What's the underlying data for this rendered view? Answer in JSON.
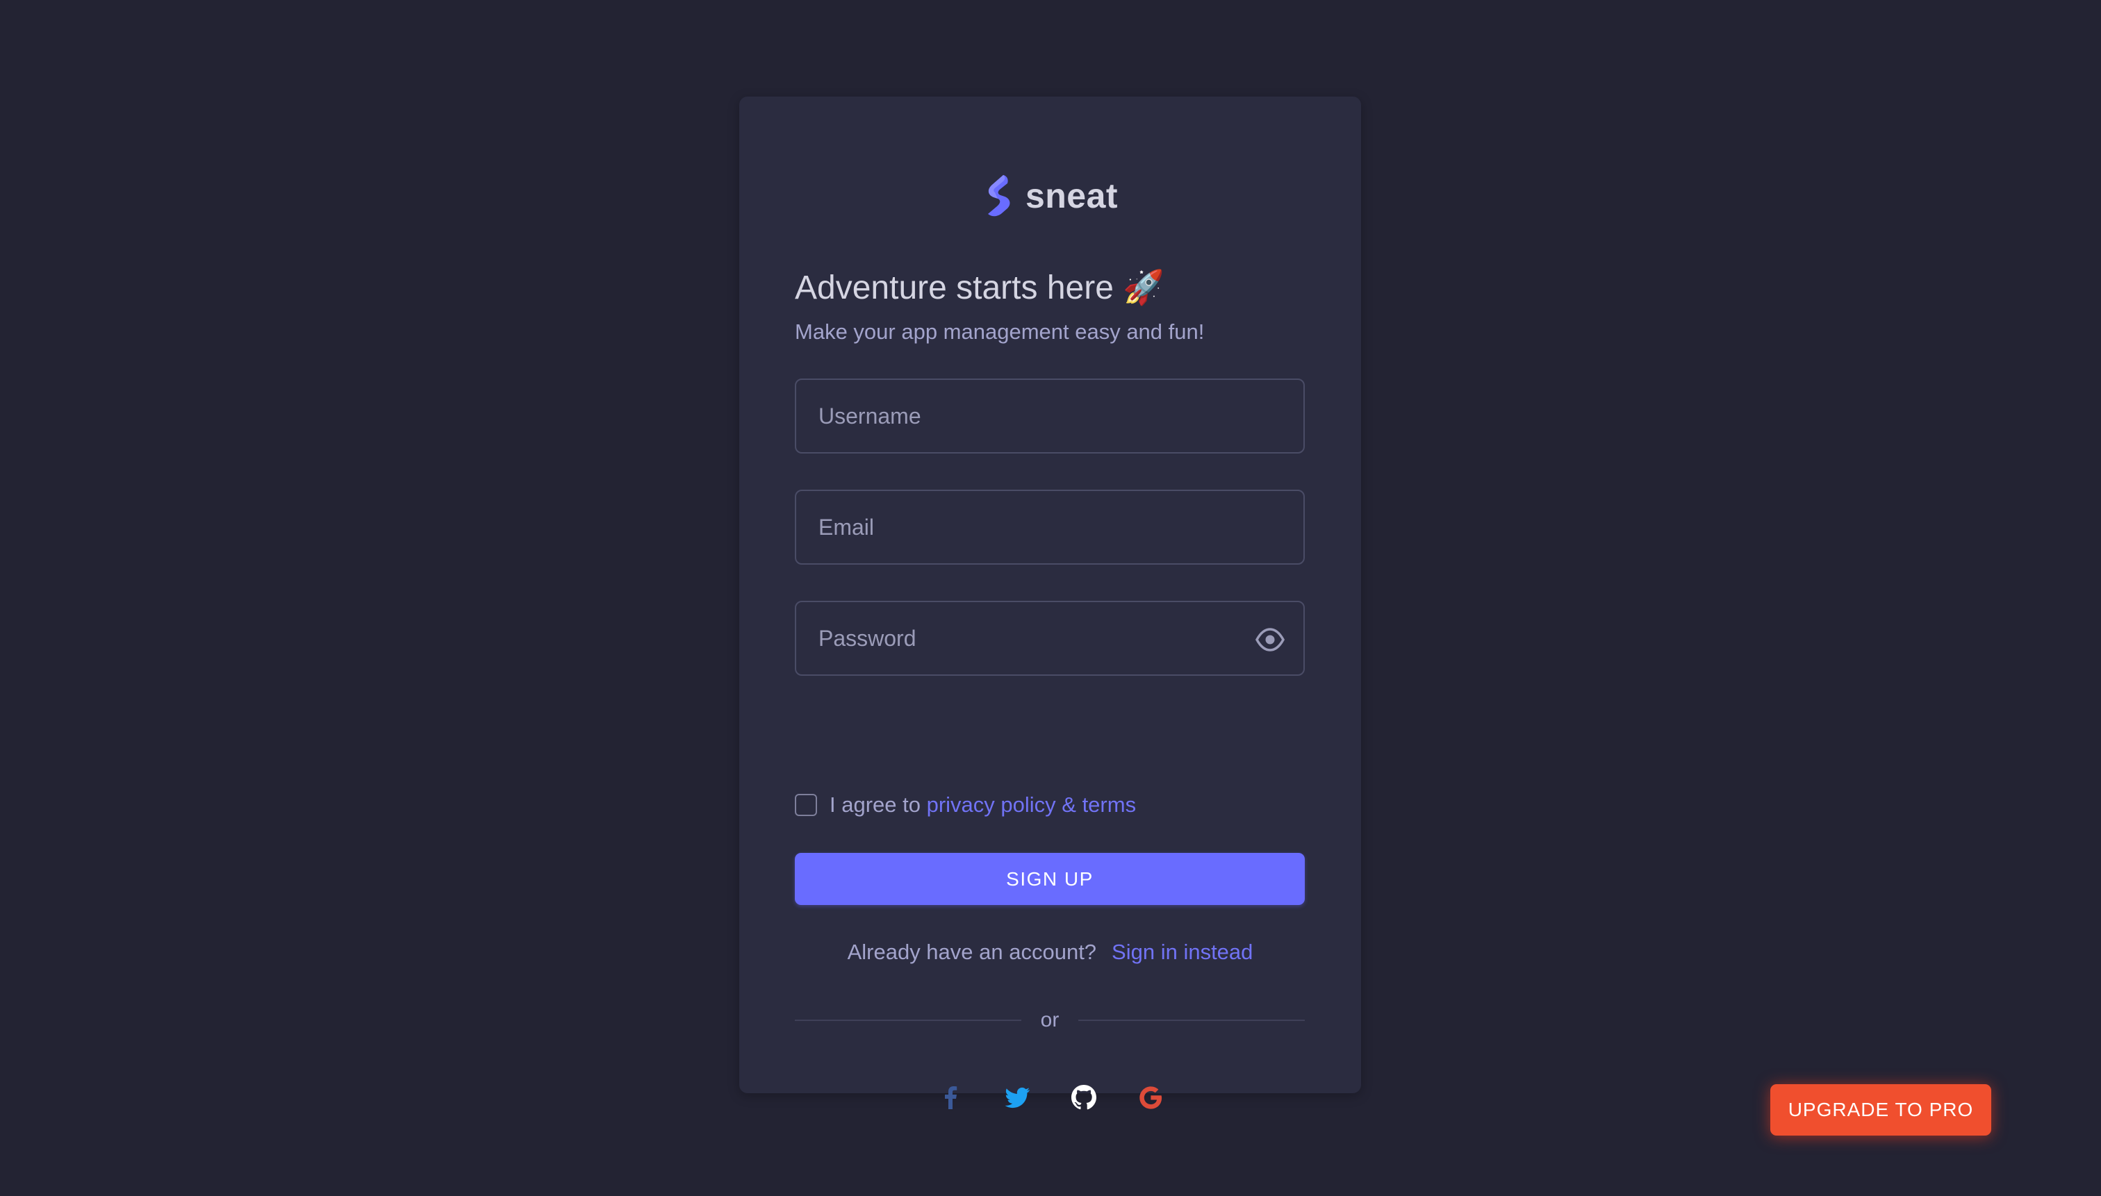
{
  "brand": {
    "name": "sneat",
    "logo_icon": "sneat-logo-icon",
    "logo_color": "#696cff"
  },
  "heading": {
    "title": "Adventure starts here 🚀",
    "subtitle": "Make your app management easy and fun!"
  },
  "form": {
    "username": {
      "placeholder": "Username",
      "value": ""
    },
    "email": {
      "placeholder": "Email",
      "value": ""
    },
    "password": {
      "placeholder": "Password",
      "value": "",
      "toggle_icon": "eye-icon"
    },
    "agree": {
      "checked": false,
      "text": "I agree to",
      "link": "privacy policy & terms"
    },
    "submit_label": "SIGN UP"
  },
  "signin": {
    "prompt": "Already have an account?",
    "link": "Sign in instead"
  },
  "divider": {
    "text": "or"
  },
  "socials": [
    {
      "name": "facebook-icon",
      "color": "#3b5998"
    },
    {
      "name": "twitter-icon",
      "color": "#1da1f2"
    },
    {
      "name": "github-icon",
      "color": "#ffffff"
    },
    {
      "name": "google-icon",
      "color": "#dd4b39"
    }
  ],
  "upgrade": {
    "label": "UPGRADE TO PRO",
    "color": "#ff3e1d"
  },
  "colors": {
    "background": "#232333",
    "card": "#2b2c40",
    "primary": "#696cff",
    "text": "#d5d5e2",
    "muted": "#a3a4cc"
  }
}
